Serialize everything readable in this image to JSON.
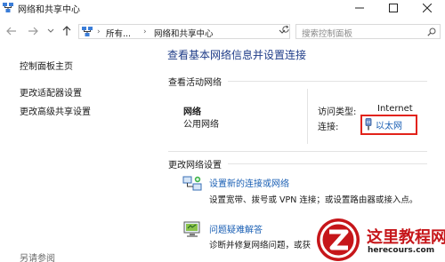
{
  "window": {
    "title": "网络和共享中心",
    "icon": "network-center-icon",
    "controls": [
      "minimize-icon",
      "maximize-icon",
      "close-icon"
    ]
  },
  "nav": {
    "back_icon": "arrow-left-icon",
    "forward_icon": "arrow-right-icon",
    "recent_icon": "chevron-down-icon",
    "up_icon": "arrow-up-icon",
    "address": {
      "root": "所有...",
      "current": "网络和共享中心"
    },
    "search_placeholder": "搜索控制面板"
  },
  "left_pane": {
    "items": [
      {
        "label": "控制面板主页"
      },
      {
        "label": "更改适配器设置"
      },
      {
        "label": "更改高级共享设置"
      }
    ],
    "see_also": "另请参阅"
  },
  "main": {
    "title": "查看基本网络信息并设置连接",
    "active_networks_label": "查看活动网络",
    "network": {
      "name": "网络",
      "category": "公用网络",
      "access_type_label": "访问类型:",
      "access_type_value": "Internet",
      "connections_label": "连接:",
      "connection_name": "以太网"
    },
    "change_settings_label": "更改网络设置",
    "actions": [
      {
        "title": "设置新的连接或网络",
        "description": "设置宽带、拨号或 VPN 连接；或设置路由器或接入点。",
        "icon": "new-connection-icon"
      },
      {
        "title": "问题疑难解答",
        "description": "诊断并修复网络问题，或获",
        "icon": "troubleshoot-icon"
      }
    ]
  },
  "watermark": {
    "title": "这里教程网",
    "url": "herecours.com"
  },
  "colors": {
    "accent_link": "#1a5fb4",
    "title_blue": "#1f3c88",
    "highlight_red": "#e2231a",
    "watermark_red": "#c6161a"
  }
}
